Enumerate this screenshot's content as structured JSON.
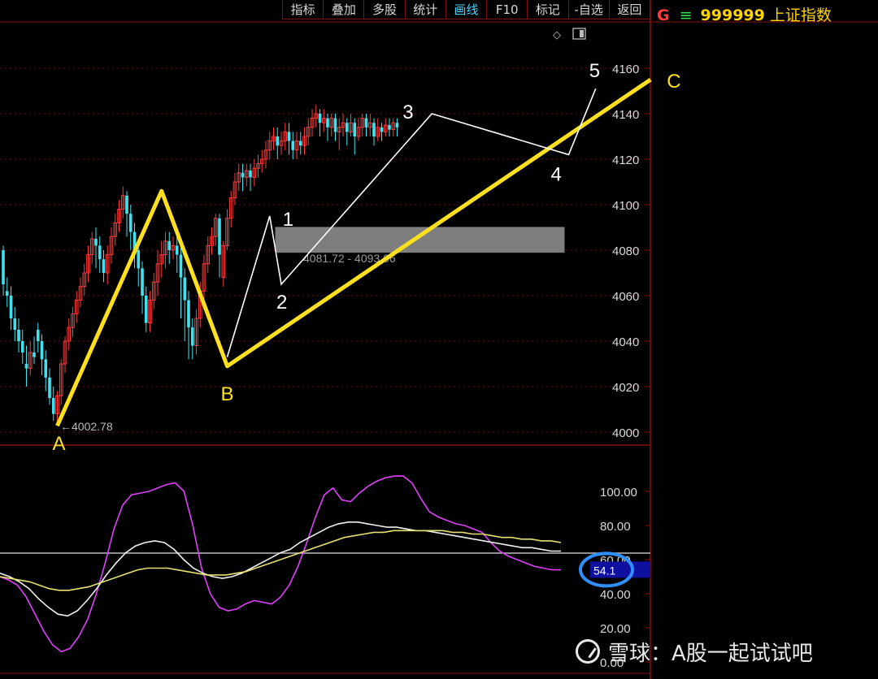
{
  "toolbar": {
    "items": [
      {
        "label": "指标",
        "active": false
      },
      {
        "label": "叠加",
        "active": false
      },
      {
        "label": "多股",
        "active": false
      },
      {
        "label": "统计",
        "active": false
      },
      {
        "label": "画线",
        "active": true
      },
      {
        "label": "F10",
        "active": false
      },
      {
        "label": "标记",
        "active": false
      },
      {
        "label": "-自选",
        "active": false
      },
      {
        "label": "返回",
        "active": false
      }
    ]
  },
  "header": {
    "market": "G",
    "eq_icon": "≡",
    "code": "999999",
    "name": "上证指数"
  },
  "watermark": {
    "icon": "xueqiu-logo-icon",
    "text": "雪球：A股一起试试吧"
  },
  "colors": {
    "up": "#ff3b3b",
    "down": "#3fe3f0",
    "border": "#8a1111",
    "wave_yellow": "#ffe020",
    "macd_fast": "#e040fb",
    "macd_mid": "#f0f0f0",
    "macd_slow": "#e8e070",
    "hl_circle": "#2f8fff",
    "zone_fill": "#8c8c8c"
  },
  "chart_data": [
    {
      "type": "candlestick",
      "title": "",
      "y_ticks": [
        4000,
        4020,
        4040,
        4060,
        4080,
        4100,
        4120,
        4140,
        4160
      ],
      "ylim": [
        4000,
        4165
      ],
      "low_marker_label": "←4002.78",
      "low_marker_value": 4002.78,
      "zone": {
        "label": "4081.72 - 4093.06",
        "low": 4081.72,
        "high": 4093.06,
        "from_bar": 54,
        "to_bar": 106
      },
      "candles": [
        [
          4080,
          4065,
          4082,
          4060
        ],
        [
          4062,
          4060,
          4068,
          4055
        ],
        [
          4060,
          4050,
          4064,
          4045
        ],
        [
          4050,
          4045,
          4055,
          4040
        ],
        [
          4045,
          4040,
          4050,
          4035
        ],
        [
          4040,
          4035,
          4045,
          4030
        ],
        [
          4030,
          4028,
          4038,
          4020
        ],
        [
          4028,
          4035,
          4040,
          4025
        ],
        [
          4035,
          4033,
          4042,
          4030
        ],
        [
          4045,
          4040,
          4048,
          4035
        ],
        [
          4040,
          4032,
          4043,
          4025
        ],
        [
          4032,
          4024,
          4036,
          4018
        ],
        [
          4024,
          4015,
          4028,
          4012
        ],
        [
          4015,
          4008,
          4020,
          4005
        ],
        [
          4008,
          4016,
          4018,
          4003
        ],
        [
          4016,
          4030,
          4032,
          4012
        ],
        [
          4030,
          4040,
          4042,
          4026
        ],
        [
          4040,
          4046,
          4050,
          4036
        ],
        [
          4046,
          4052,
          4055,
          4042
        ],
        [
          4052,
          4058,
          4062,
          4048
        ],
        [
          4058,
          4064,
          4068,
          4055
        ],
        [
          4064,
          4070,
          4074,
          4060
        ],
        [
          4070,
          4078,
          4082,
          4066
        ],
        [
          4078,
          4085,
          4088,
          4074
        ],
        [
          4085,
          4082,
          4090,
          4072
        ],
        [
          4082,
          4076,
          4086,
          4070
        ],
        [
          4076,
          4070,
          4080,
          4066
        ],
        [
          4070,
          4078,
          4082,
          4065
        ],
        [
          4078,
          4086,
          4090,
          4074
        ],
        [
          4086,
          4092,
          4096,
          4082
        ],
        [
          4092,
          4098,
          4102,
          4088
        ],
        [
          4098,
          4104,
          4108,
          4094
        ],
        [
          4104,
          4096,
          4106,
          4086
        ],
        [
          4096,
          4088,
          4100,
          4080
        ],
        [
          4088,
          4080,
          4092,
          4072
        ],
        [
          4080,
          4072,
          4084,
          4064
        ],
        [
          4072,
          4060,
          4075,
          4052
        ],
        [
          4060,
          4048,
          4064,
          4044
        ],
        [
          4048,
          4058,
          4062,
          4044
        ],
        [
          4058,
          4066,
          4070,
          4054
        ],
        [
          4066,
          4074,
          4080,
          4060
        ],
        [
          4074,
          4078,
          4084,
          4068
        ],
        [
          4078,
          4084,
          4088,
          4072
        ],
        [
          4084,
          4080,
          4088,
          4074
        ],
        [
          4080,
          4082,
          4086,
          4076
        ],
        [
          4082,
          4078,
          4086,
          4070
        ],
        [
          4078,
          4068,
          4082,
          4050
        ],
        [
          4068,
          4058,
          4072,
          4040
        ],
        [
          4058,
          4046,
          4062,
          4032
        ],
        [
          4046,
          4038,
          4050,
          4032
        ],
        [
          4038,
          4050,
          4054,
          4034
        ],
        [
          4050,
          4062,
          4066,
          4046
        ],
        [
          4062,
          4074,
          4078,
          4058
        ],
        [
          4074,
          4082,
          4086,
          4070
        ],
        [
          4082,
          4086,
          4090,
          4078
        ],
        [
          4086,
          4094,
          4096,
          4082
        ],
        [
          4094,
          4078,
          4096,
          4068
        ],
        [
          4068,
          4082,
          4084,
          4064
        ],
        [
          4082,
          4094,
          4098,
          4080
        ],
        [
          4094,
          4103,
          4106,
          4090
        ],
        [
          4103,
          4110,
          4114,
          4100
        ],
        [
          4110,
          4114,
          4118,
          4106
        ],
        [
          4114,
          4112,
          4118,
          4106
        ],
        [
          4112,
          4115,
          4118,
          4108
        ],
        [
          4115,
          4112,
          4118,
          4106
        ],
        [
          4112,
          4116,
          4120,
          4108
        ],
        [
          4116,
          4118,
          4122,
          4112
        ],
        [
          4118,
          4120,
          4124,
          4114
        ],
        [
          4120,
          4124,
          4128,
          4116
        ],
        [
          4124,
          4128,
          4132,
          4120
        ],
        [
          4128,
          4130,
          4134,
          4124
        ],
        [
          4130,
          4126,
          4134,
          4120
        ],
        [
          4126,
          4128,
          4132,
          4122
        ],
        [
          4128,
          4132,
          4136,
          4124
        ],
        [
          4132,
          4128,
          4136,
          4122
        ],
        [
          4128,
          4124,
          4132,
          4120
        ],
        [
          4124,
          4128,
          4132,
          4120
        ],
        [
          4128,
          4126,
          4132,
          4122
        ],
        [
          4126,
          4130,
          4134,
          4122
        ],
        [
          4130,
          4134,
          4138,
          4126
        ],
        [
          4134,
          4138,
          4142,
          4130
        ],
        [
          4138,
          4140,
          4144,
          4134
        ],
        [
          4140,
          4136,
          4142,
          4130
        ],
        [
          4136,
          4138,
          4142,
          4132
        ],
        [
          4138,
          4134,
          4140,
          4128
        ],
        [
          4134,
          4138,
          4140,
          4130
        ],
        [
          4138,
          4132,
          4140,
          4128
        ],
        [
          4132,
          4134,
          4138,
          4124
        ],
        [
          4134,
          4136,
          4140,
          4130
        ],
        [
          4136,
          4132,
          4138,
          4126
        ],
        [
          4132,
          4136,
          4140,
          4130
        ],
        [
          4136,
          4130,
          4138,
          4122
        ],
        [
          4130,
          4134,
          4138,
          4128
        ],
        [
          4134,
          4138,
          4140,
          4130
        ],
        [
          4138,
          4134,
          4140,
          4130
        ],
        [
          4134,
          4136,
          4140,
          4130
        ],
        [
          4136,
          4130,
          4138,
          4126
        ],
        [
          4130,
          4134,
          4138,
          4128
        ],
        [
          4134,
          4132,
          4136,
          4128
        ],
        [
          4132,
          4135,
          4138,
          4130
        ],
        [
          4135,
          4133,
          4138,
          4130
        ],
        [
          4133,
          4136,
          4138,
          4130
        ],
        [
          4136,
          4134,
          4138,
          4130
        ]
      ],
      "wave_abc": [
        {
          "label": "A",
          "bar": 14,
          "value": 4002.78
        },
        {
          "label": "",
          "bar": 41,
          "value": 4106
        },
        {
          "label": "B",
          "bar": 58,
          "value": 4029
        },
        {
          "label": "C",
          "bar": 155,
          "value": 4155
        }
      ],
      "wave_12345": [
        {
          "label": "",
          "bar": 58,
          "value": 4033
        },
        {
          "label": "1",
          "bar": 69,
          "value": 4095
        },
        {
          "label": "2",
          "bar": 72,
          "value": 4065
        },
        {
          "label": "3",
          "bar": 111,
          "value": 4140
        },
        {
          "label": "4",
          "bar": 138,
          "value": 4122
        },
        {
          "label": "5",
          "bar": 145,
          "value": 4151
        }
      ]
    },
    {
      "type": "line",
      "title": "",
      "y_ticks": [
        0,
        20,
        40,
        60,
        80,
        100
      ],
      "ylim": [
        0,
        110
      ],
      "highlight_value": "54.1",
      "series": [
        {
          "name": "",
          "color_key": "macd_fast",
          "values": [
            50,
            48,
            45,
            38,
            28,
            18,
            10,
            6,
            8,
            15,
            25,
            40,
            58,
            78,
            92,
            98,
            99,
            100,
            102,
            104,
            105,
            100,
            80,
            55,
            40,
            32,
            30,
            31,
            34,
            36,
            35,
            34,
            38,
            45,
            56,
            70,
            85,
            98,
            102,
            95,
            94,
            99,
            103,
            106,
            108,
            109,
            109,
            105,
            96,
            88,
            85,
            83,
            81,
            80,
            78,
            76,
            70,
            65,
            62,
            60,
            58,
            56,
            55,
            54,
            54
          ]
        },
        {
          "name": "",
          "color_key": "macd_mid",
          "values": [
            52,
            50,
            47,
            43,
            37,
            32,
            28,
            27,
            30,
            36,
            43,
            51,
            58,
            64,
            68,
            70,
            71,
            70,
            66,
            60,
            55,
            52,
            50,
            49,
            50,
            52,
            55,
            58,
            61,
            64,
            66,
            70,
            73,
            76,
            79,
            81,
            82,
            82,
            81,
            80,
            79,
            79,
            78,
            77,
            77,
            76,
            75,
            74,
            73,
            72,
            71,
            70,
            69,
            68,
            67,
            67,
            66,
            65,
            65
          ]
        },
        {
          "name": "",
          "color_key": "macd_slow",
          "values": [
            50,
            49,
            48,
            47,
            45,
            43,
            42,
            42,
            43,
            44,
            46,
            48,
            50,
            52,
            54,
            55,
            55,
            55,
            54,
            53,
            52,
            51,
            51,
            51,
            52,
            53,
            55,
            57,
            59,
            61,
            63,
            65,
            67,
            69,
            71,
            73,
            74,
            75,
            76,
            76,
            77,
            77,
            77,
            77,
            77,
            77,
            76,
            76,
            75,
            75,
            74,
            73,
            73,
            72,
            72,
            71,
            71,
            70
          ]
        }
      ]
    }
  ]
}
